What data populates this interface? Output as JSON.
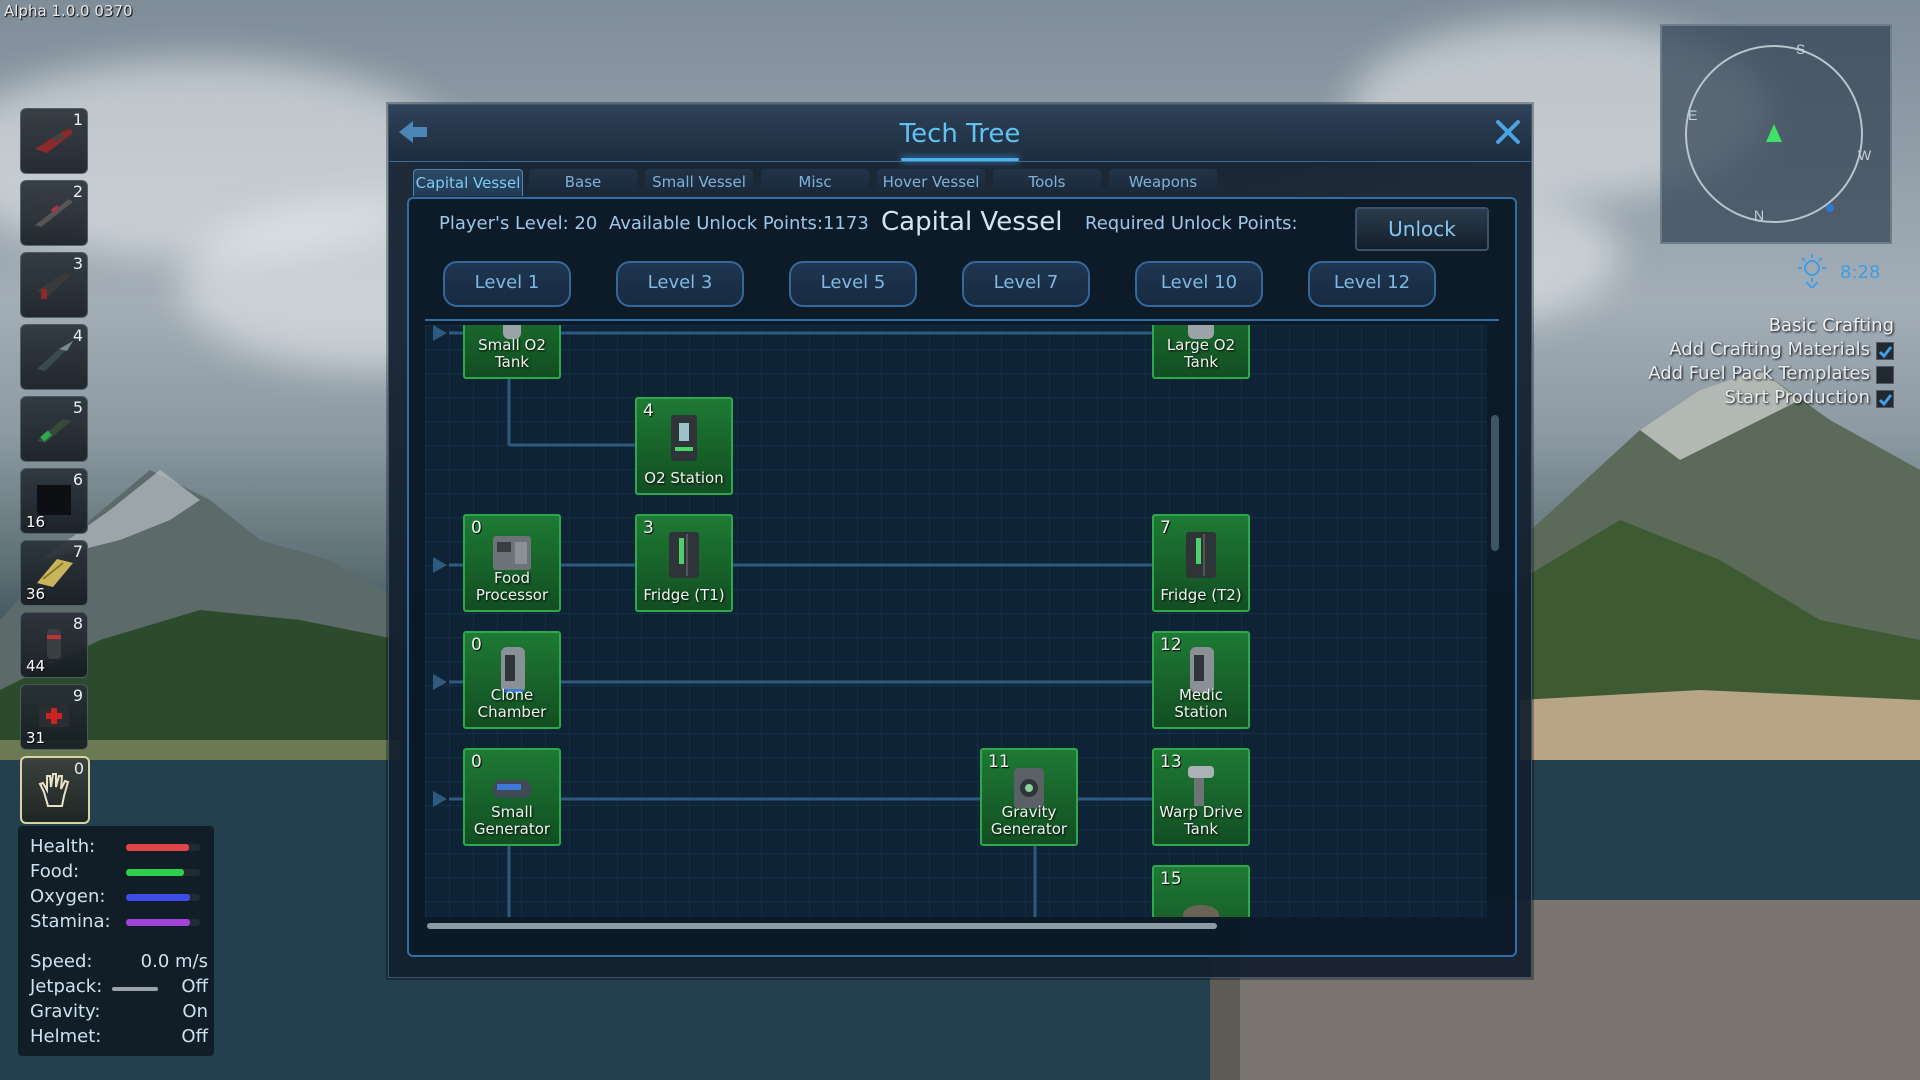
{
  "version": "Alpha 1.0.0 0370",
  "hotbar": [
    {
      "num": "1",
      "count": "",
      "icon": "rifle-icon"
    },
    {
      "num": "2",
      "count": "",
      "icon": "sniper-icon"
    },
    {
      "num": "3",
      "count": "",
      "icon": "pistol-icon"
    },
    {
      "num": "4",
      "count": "",
      "icon": "drill-icon"
    },
    {
      "num": "5",
      "count": "",
      "icon": "chainsaw-icon"
    },
    {
      "num": "6",
      "count": "16",
      "icon": "block-icon"
    },
    {
      "num": "7",
      "count": "36",
      "icon": "plank-icon"
    },
    {
      "num": "8",
      "count": "44",
      "icon": "canister-icon"
    },
    {
      "num": "9",
      "count": "31",
      "icon": "medkit-icon"
    },
    {
      "num": "0",
      "count": "",
      "icon": "hand-icon"
    }
  ],
  "stats": {
    "health": {
      "label": "Health:",
      "level": 0.85,
      "color": "#e04646"
    },
    "food": {
      "label": "Food:",
      "level": 0.78,
      "color": "#2ecf4a"
    },
    "oxygen": {
      "label": "Oxygen:",
      "level": 0.86,
      "color": "#3d4ee8"
    },
    "stamina": {
      "label": "Stamina:",
      "level": 0.86,
      "color": "#a342d8"
    },
    "speed": {
      "label": "Speed:",
      "value": "0.0 m/s"
    },
    "jetpack": {
      "label": "Jetpack:",
      "value": "Off"
    },
    "gravity": {
      "label": "Gravity:",
      "value": "On"
    },
    "helmet": {
      "label": "Helmet:",
      "value": "Off"
    }
  },
  "window": {
    "title": "Tech Tree",
    "tabs": [
      "Capital Vessel",
      "Base",
      "Small Vessel",
      "Misc",
      "Hover Vessel",
      "Tools",
      "Weapons"
    ],
    "active_tab": "Capital Vessel",
    "player_level": "Player's Level: 20",
    "unlock_points": "Available Unlock Points:1173",
    "category": "Capital Vessel",
    "required_points": "Required Unlock Points:",
    "unlock_label": "Unlock",
    "levels": [
      "Level 1",
      "Level 3",
      "Level 5",
      "Level 7",
      "Level 10",
      "Level 12"
    ]
  },
  "tree_nodes": [
    {
      "cost": "",
      "label": "Small O2 Tank",
      "icon": "o2-tank-icon"
    },
    {
      "cost": "",
      "label": "Large O2 Tank",
      "icon": "o2-tank-icon"
    },
    {
      "cost": "4",
      "label": "O2 Station",
      "icon": "o2-station-icon"
    },
    {
      "cost": "0",
      "label": "Food Processor",
      "icon": "food-processor-icon"
    },
    {
      "cost": "3",
      "label": "Fridge (T1)",
      "icon": "fridge-icon"
    },
    {
      "cost": "7",
      "label": "Fridge (T2)",
      "icon": "fridge-icon"
    },
    {
      "cost": "0",
      "label": "Clone Chamber",
      "icon": "clone-chamber-icon"
    },
    {
      "cost": "12",
      "label": "Medic Station",
      "icon": "medic-station-icon"
    },
    {
      "cost": "0",
      "label": "Small Generator",
      "icon": "generator-icon"
    },
    {
      "cost": "11",
      "label": "Gravity Generator",
      "icon": "gravity-generator-icon"
    },
    {
      "cost": "13",
      "label": "Warp Drive Tank",
      "icon": "warp-tank-icon"
    },
    {
      "cost": "15",
      "label": "",
      "icon": "warp-drive-icon"
    }
  ],
  "clock": "8:28",
  "tasks": {
    "title": "Basic Crafting",
    "items": [
      {
        "label": "Add Crafting Materials",
        "done": true
      },
      {
        "label": "Add Fuel Pack Templates",
        "done": false
      },
      {
        "label": "Start Production",
        "done": true
      }
    ]
  },
  "compass": {
    "n": "N",
    "e": "E",
    "s": "S",
    "w": "W"
  }
}
